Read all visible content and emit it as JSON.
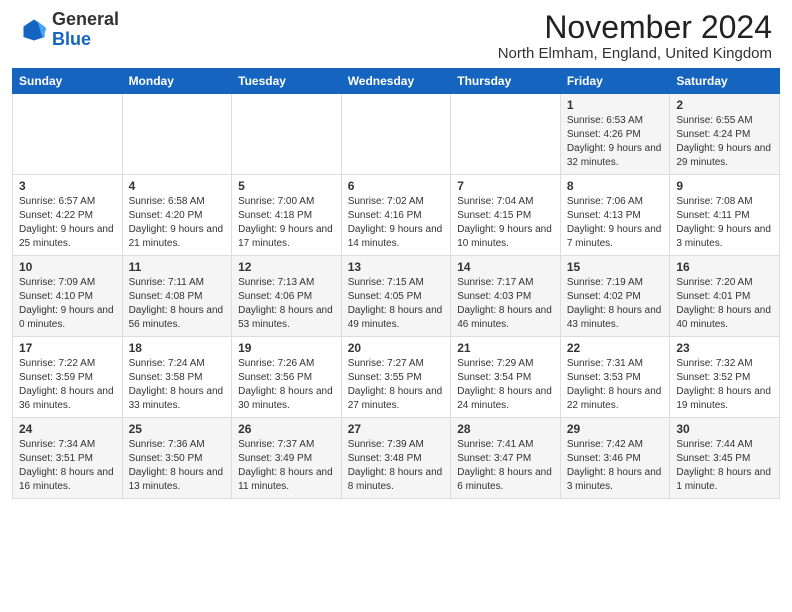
{
  "header": {
    "logo_general": "General",
    "logo_blue": "Blue",
    "month_title": "November 2024",
    "location": "North Elmham, England, United Kingdom"
  },
  "weekdays": [
    "Sunday",
    "Monday",
    "Tuesday",
    "Wednesday",
    "Thursday",
    "Friday",
    "Saturday"
  ],
  "weeks": [
    [
      {
        "day": "",
        "info": ""
      },
      {
        "day": "",
        "info": ""
      },
      {
        "day": "",
        "info": ""
      },
      {
        "day": "",
        "info": ""
      },
      {
        "day": "",
        "info": ""
      },
      {
        "day": "1",
        "info": "Sunrise: 6:53 AM\nSunset: 4:26 PM\nDaylight: 9 hours and 32 minutes."
      },
      {
        "day": "2",
        "info": "Sunrise: 6:55 AM\nSunset: 4:24 PM\nDaylight: 9 hours and 29 minutes."
      }
    ],
    [
      {
        "day": "3",
        "info": "Sunrise: 6:57 AM\nSunset: 4:22 PM\nDaylight: 9 hours and 25 minutes."
      },
      {
        "day": "4",
        "info": "Sunrise: 6:58 AM\nSunset: 4:20 PM\nDaylight: 9 hours and 21 minutes."
      },
      {
        "day": "5",
        "info": "Sunrise: 7:00 AM\nSunset: 4:18 PM\nDaylight: 9 hours and 17 minutes."
      },
      {
        "day": "6",
        "info": "Sunrise: 7:02 AM\nSunset: 4:16 PM\nDaylight: 9 hours and 14 minutes."
      },
      {
        "day": "7",
        "info": "Sunrise: 7:04 AM\nSunset: 4:15 PM\nDaylight: 9 hours and 10 minutes."
      },
      {
        "day": "8",
        "info": "Sunrise: 7:06 AM\nSunset: 4:13 PM\nDaylight: 9 hours and 7 minutes."
      },
      {
        "day": "9",
        "info": "Sunrise: 7:08 AM\nSunset: 4:11 PM\nDaylight: 9 hours and 3 minutes."
      }
    ],
    [
      {
        "day": "10",
        "info": "Sunrise: 7:09 AM\nSunset: 4:10 PM\nDaylight: 9 hours and 0 minutes."
      },
      {
        "day": "11",
        "info": "Sunrise: 7:11 AM\nSunset: 4:08 PM\nDaylight: 8 hours and 56 minutes."
      },
      {
        "day": "12",
        "info": "Sunrise: 7:13 AM\nSunset: 4:06 PM\nDaylight: 8 hours and 53 minutes."
      },
      {
        "day": "13",
        "info": "Sunrise: 7:15 AM\nSunset: 4:05 PM\nDaylight: 8 hours and 49 minutes."
      },
      {
        "day": "14",
        "info": "Sunrise: 7:17 AM\nSunset: 4:03 PM\nDaylight: 8 hours and 46 minutes."
      },
      {
        "day": "15",
        "info": "Sunrise: 7:19 AM\nSunset: 4:02 PM\nDaylight: 8 hours and 43 minutes."
      },
      {
        "day": "16",
        "info": "Sunrise: 7:20 AM\nSunset: 4:01 PM\nDaylight: 8 hours and 40 minutes."
      }
    ],
    [
      {
        "day": "17",
        "info": "Sunrise: 7:22 AM\nSunset: 3:59 PM\nDaylight: 8 hours and 36 minutes."
      },
      {
        "day": "18",
        "info": "Sunrise: 7:24 AM\nSunset: 3:58 PM\nDaylight: 8 hours and 33 minutes."
      },
      {
        "day": "19",
        "info": "Sunrise: 7:26 AM\nSunset: 3:56 PM\nDaylight: 8 hours and 30 minutes."
      },
      {
        "day": "20",
        "info": "Sunrise: 7:27 AM\nSunset: 3:55 PM\nDaylight: 8 hours and 27 minutes."
      },
      {
        "day": "21",
        "info": "Sunrise: 7:29 AM\nSunset: 3:54 PM\nDaylight: 8 hours and 24 minutes."
      },
      {
        "day": "22",
        "info": "Sunrise: 7:31 AM\nSunset: 3:53 PM\nDaylight: 8 hours and 22 minutes."
      },
      {
        "day": "23",
        "info": "Sunrise: 7:32 AM\nSunset: 3:52 PM\nDaylight: 8 hours and 19 minutes."
      }
    ],
    [
      {
        "day": "24",
        "info": "Sunrise: 7:34 AM\nSunset: 3:51 PM\nDaylight: 8 hours and 16 minutes."
      },
      {
        "day": "25",
        "info": "Sunrise: 7:36 AM\nSunset: 3:50 PM\nDaylight: 8 hours and 13 minutes."
      },
      {
        "day": "26",
        "info": "Sunrise: 7:37 AM\nSunset: 3:49 PM\nDaylight: 8 hours and 11 minutes."
      },
      {
        "day": "27",
        "info": "Sunrise: 7:39 AM\nSunset: 3:48 PM\nDaylight: 8 hours and 8 minutes."
      },
      {
        "day": "28",
        "info": "Sunrise: 7:41 AM\nSunset: 3:47 PM\nDaylight: 8 hours and 6 minutes."
      },
      {
        "day": "29",
        "info": "Sunrise: 7:42 AM\nSunset: 3:46 PM\nDaylight: 8 hours and 3 minutes."
      },
      {
        "day": "30",
        "info": "Sunrise: 7:44 AM\nSunset: 3:45 PM\nDaylight: 8 hours and 1 minute."
      }
    ]
  ]
}
